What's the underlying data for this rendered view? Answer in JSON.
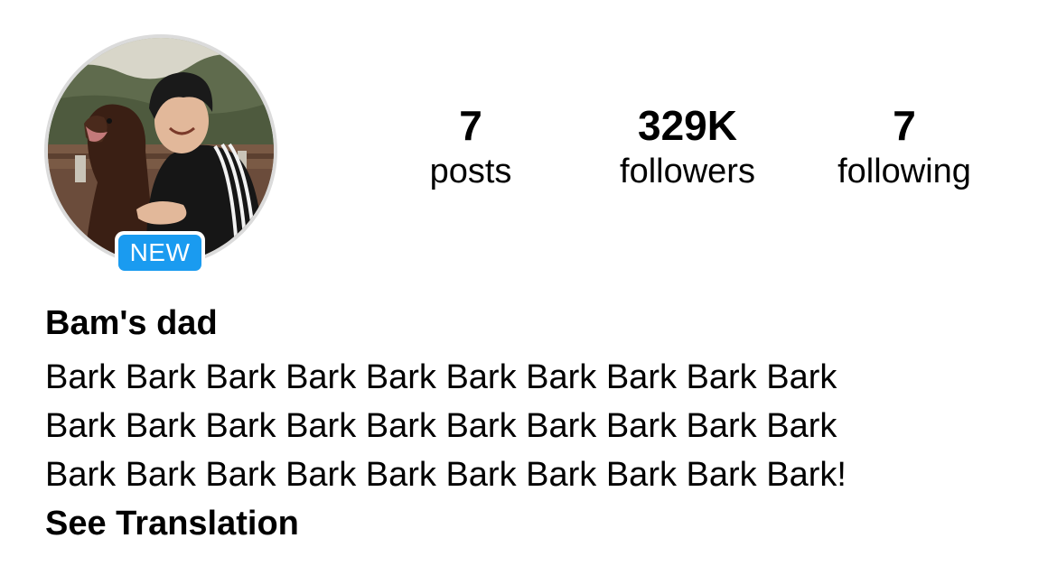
{
  "profile": {
    "badge": "NEW",
    "name": "Bam's dad",
    "see_translation": "See Translation"
  },
  "stats": {
    "posts": {
      "value": "7",
      "label": "posts"
    },
    "followers": {
      "value": "329K",
      "label": "followers"
    },
    "following": {
      "value": "7",
      "label": "following"
    }
  },
  "bio": {
    "lines": [
      "Bark Bark Bark Bark Bark Bark Bark Bark Bark Bark",
      "Bark Bark Bark Bark Bark Bark Bark Bark Bark Bark",
      "Bark Bark Bark Bark Bark Bark Bark Bark Bark Bark!"
    ]
  },
  "colors": {
    "badge_blue": "#1a9bf0",
    "avatar_ring": "#dbdbdb",
    "text": "#000000"
  }
}
